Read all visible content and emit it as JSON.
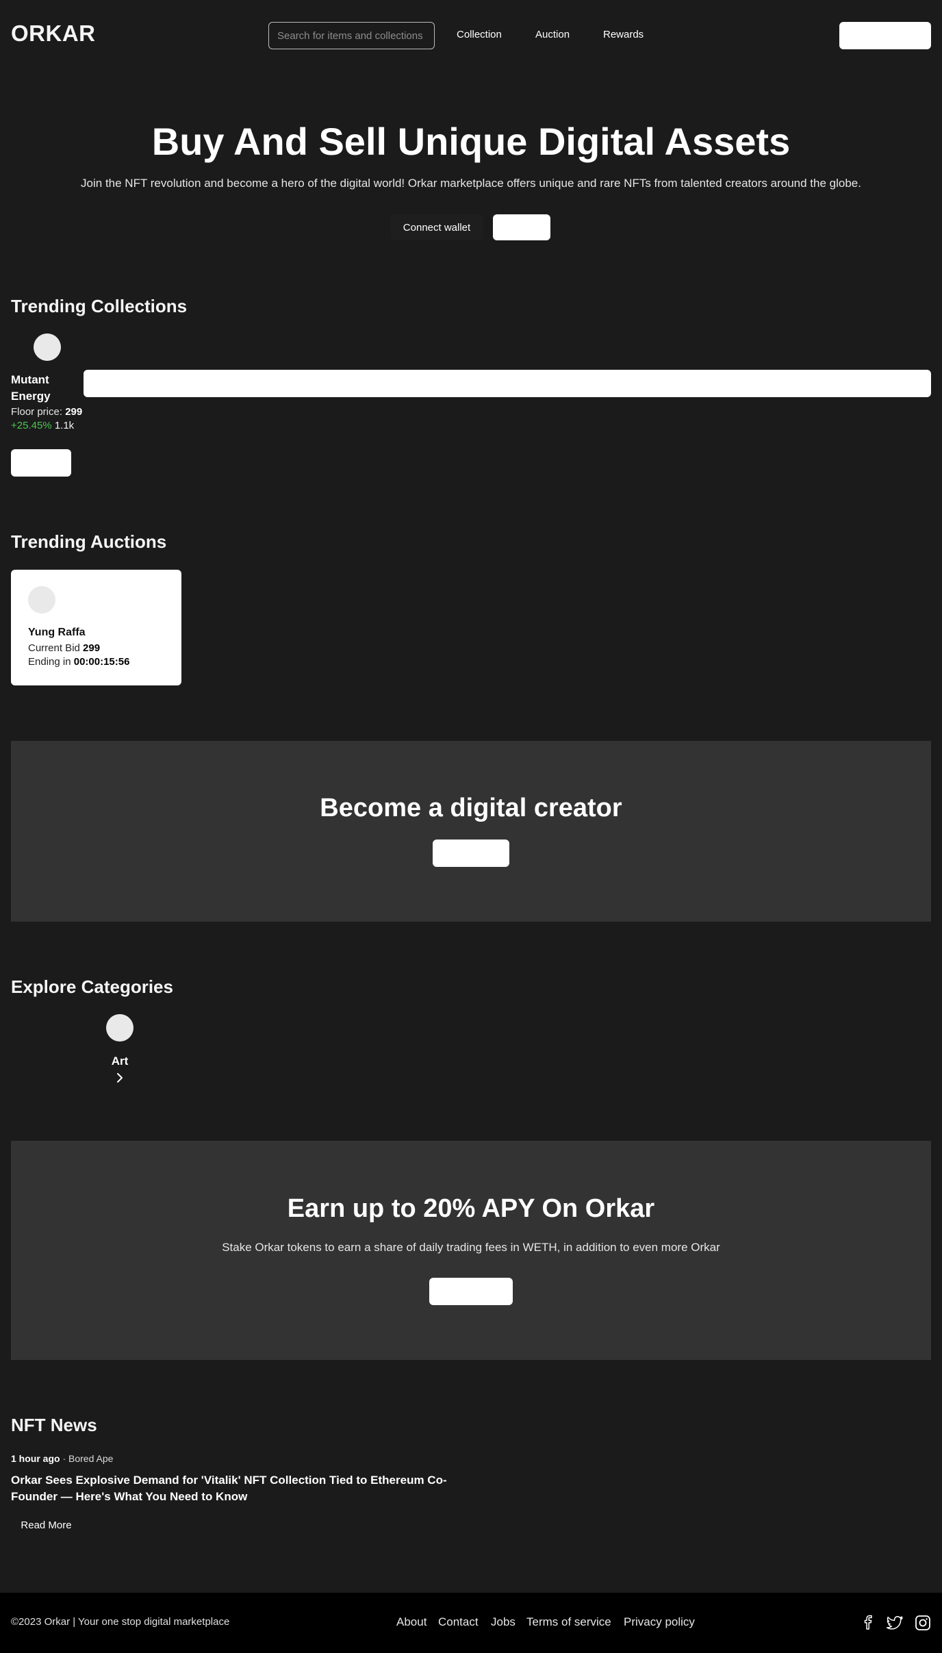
{
  "header": {
    "logo": "ORKAR",
    "search_placeholder": "Search for items and collections",
    "nav": [
      "Collection",
      "Auction",
      "Rewards"
    ]
  },
  "hero": {
    "title": "Buy And Sell Unique Digital Assets",
    "subtitle": "Join the NFT revolution and become a hero of the digital world! Orkar marketplace offers unique and rare NFTs from talented creators around the globe.",
    "connect_label": "Connect wallet"
  },
  "trending_collections": {
    "title": "Trending Collections",
    "item": {
      "name": "Mutant Energy",
      "floor_label": "Floor price:",
      "floor_value": "299",
      "change": "+25.45%",
      "volume": "1.1k"
    }
  },
  "trending_auctions": {
    "title": "Trending Auctions",
    "item": {
      "name": "Yung Raffa",
      "bid_label": "Current Bid",
      "bid_value": "299",
      "ending_label": "Ending in",
      "ending_value": "00:00:15:56"
    }
  },
  "creator_banner": {
    "title": "Become a digital creator"
  },
  "categories": {
    "title": "Explore Categories",
    "items": [
      {
        "label": "Art"
      }
    ]
  },
  "apy_banner": {
    "title": "Earn up to 20% APY On Orkar",
    "subtitle": "Stake Orkar tokens to earn a share of daily trading fees in WETH, in addition to even more Orkar"
  },
  "news": {
    "title": "NFT News",
    "item": {
      "time": "1 hour ago",
      "source": "Bored Ape",
      "headline": "Orkar Sees Explosive Demand for 'Vitalik' NFT Collection Tied to Ethereum Co-Founder — Here's What You Need to Know",
      "read_more": "Read More"
    }
  },
  "footer": {
    "copyright": "©2023 Orkar | Your one stop digital marketplace",
    "links": [
      "About",
      "Contact",
      "Jobs",
      "Terms of service",
      "Privacy policy"
    ],
    "social_icons": [
      "facebook-icon",
      "twitter-icon",
      "instagram-icon"
    ]
  },
  "colors": {
    "background": "#1b1b1b",
    "banner": "#333333",
    "footer": "#000000",
    "positive": "#4cc552"
  }
}
